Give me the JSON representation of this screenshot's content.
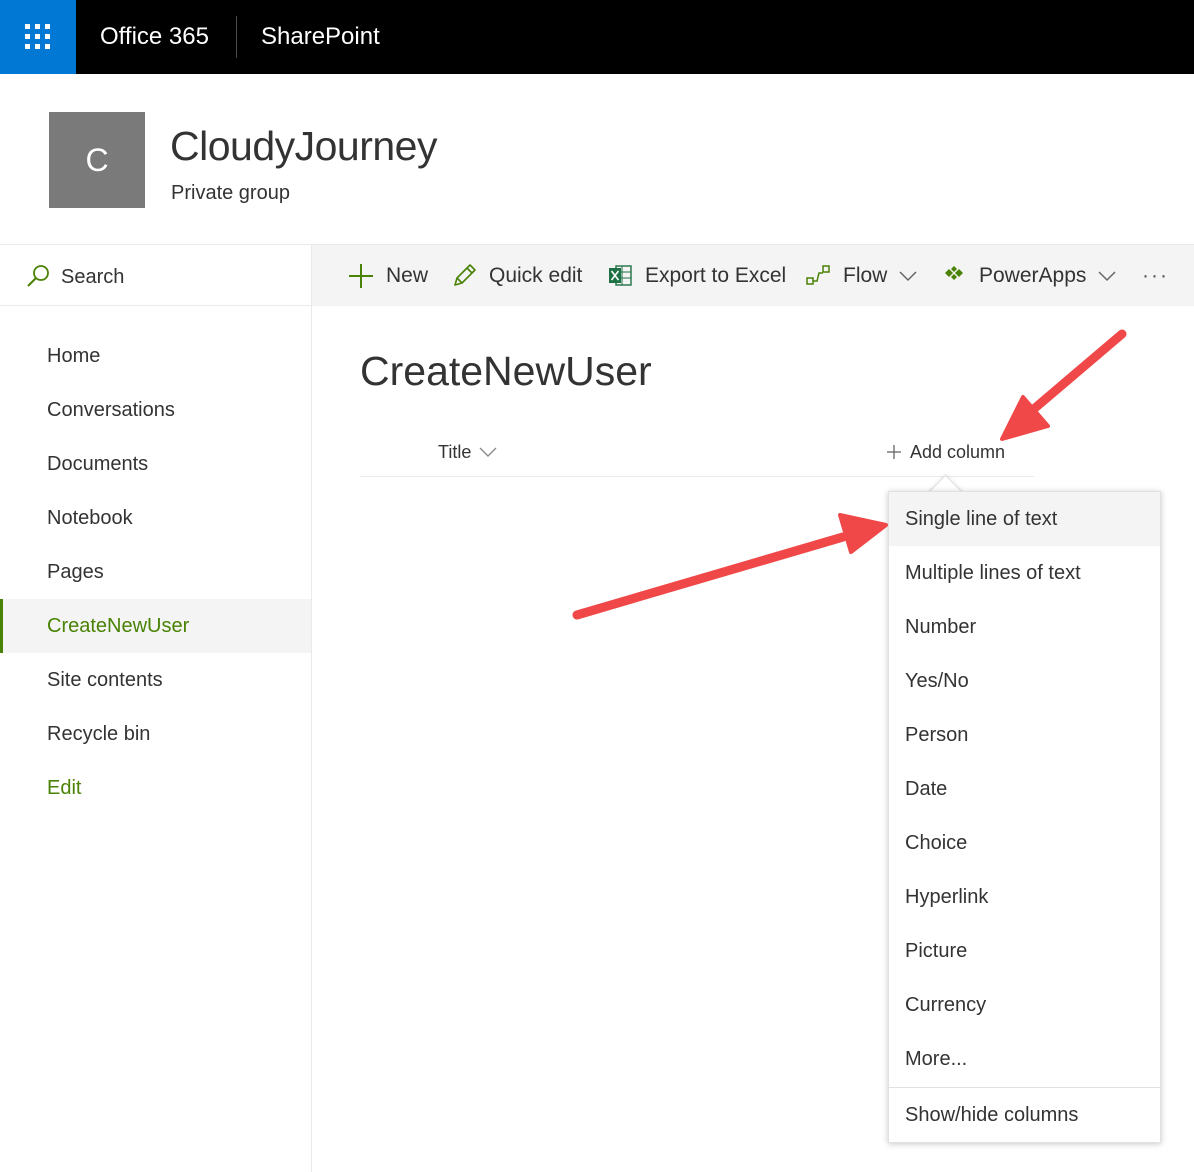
{
  "suite": {
    "brand": "Office 365",
    "app": "SharePoint"
  },
  "site": {
    "logo_letter": "C",
    "title": "CloudyJourney",
    "subtitle": "Private group"
  },
  "search": {
    "label": "Search"
  },
  "commands": {
    "new": "New",
    "quick_edit": "Quick edit",
    "export": "Export to Excel",
    "flow": "Flow",
    "powerapps": "PowerApps",
    "more": "···"
  },
  "nav": {
    "items": [
      {
        "label": "Home"
      },
      {
        "label": "Conversations"
      },
      {
        "label": "Documents"
      },
      {
        "label": "Notebook"
      },
      {
        "label": "Pages"
      },
      {
        "label": "CreateNewUser"
      },
      {
        "label": "Site contents"
      },
      {
        "label": "Recycle bin"
      },
      {
        "label": "Edit"
      }
    ],
    "active_index": 5
  },
  "list": {
    "title": "CreateNewUser",
    "column_title": "Title",
    "add_column": "Add column"
  },
  "column_menu": {
    "items": [
      {
        "label": "Single line of text"
      },
      {
        "label": "Multiple lines of text"
      },
      {
        "label": "Number"
      },
      {
        "label": "Yes/No"
      },
      {
        "label": "Person"
      },
      {
        "label": "Date"
      },
      {
        "label": "Choice"
      },
      {
        "label": "Hyperlink"
      },
      {
        "label": "Picture"
      },
      {
        "label": "Currency"
      },
      {
        "label": "More..."
      }
    ],
    "footer": "Show/hide columns"
  },
  "colors": {
    "suite_bar": "#000000",
    "waffle": "#0078d4",
    "accent_green": "#498205",
    "annotation_arrow": "#f04848"
  }
}
